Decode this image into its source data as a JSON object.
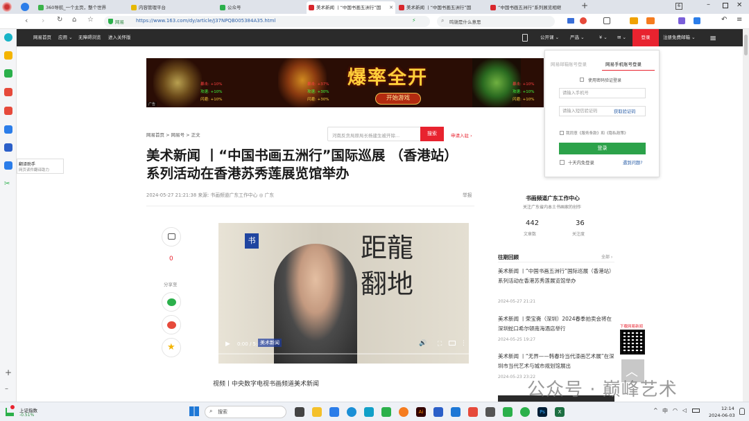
{
  "browser": {
    "tabs": [
      {
        "label": "360导航_一个主页，整个世界"
      },
      {
        "label": "内容管理平台"
      },
      {
        "label": "公众号"
      },
      {
        "label": "美术新闻 丨“中国书画五洲行”国"
      },
      {
        "label": "美术新闻 丨“中国书画五洲行”国"
      },
      {
        "label": "“中国书画五洲行”系列展览相继"
      }
    ],
    "new_tab": "+",
    "window_count": "6",
    "url_prefix": "网易",
    "url": "https://www.163.com/dy/article/J37NPQB005384A35.html",
    "search_placeholder": "鸣谢是什么意思"
  },
  "site_nav": {
    "left": [
      "网易首页",
      "应用 ⌄",
      "无障碍浏览",
      "进入关怀版"
    ],
    "right": [
      "公开课 ⌄",
      "严选 ⌄",
      "¥ ⌄",
      "✉ ⌄"
    ],
    "login": "登录",
    "register": "注册免费邮箱 ⌄"
  },
  "banner": {
    "title": "爆率全开",
    "button": "开始游戏",
    "tag": "广告",
    "stats_left": [
      "暴击: +10%",
      "攻速: +10%",
      "闪避: +10%"
    ],
    "stats_mid": [
      "暴击: +37%",
      "攻速: +30%",
      "闪避: +30%"
    ],
    "stats_right": [
      "暴击: +10%",
      "攻速: +10%",
      "闪避: +10%"
    ]
  },
  "breadcrumb": "网易首页 > 网易号 > 正文",
  "article_search": {
    "placeholder": "河南反贪局原局长杨建生被开除...",
    "button": "搜索",
    "apply": "申请入驻 ›"
  },
  "article": {
    "title": "美术新闻 丨“中国书画五洲行”国际巡展 （香港站）系列活动在香港苏秀莲展览馆举办",
    "meta": "2024-05-27 21:21:38  来源: 书画频道广东工作中心  ◎ 广东",
    "report": "举报",
    "caption": "视频丨中央数字电视书画频道美术新闻"
  },
  "share": {
    "comment_count": "0",
    "share_label": "分享至"
  },
  "video": {
    "time": "0:00 / 5:45",
    "logo_text": "美术新闻"
  },
  "login_panel": {
    "tab_email": "网易邮箱账号登录",
    "tab_phone": "网易手机账号登录",
    "pwd_login": "使用密码验证登录",
    "phone_placeholder": "请输入手机号",
    "code_placeholder": "请输入短信验证码",
    "get_code": "获取验证码",
    "agree": "我同意《服务条款》和《隐私政策》",
    "submit": "登录",
    "remember": "十天内免登录",
    "problem": "遇到问题?"
  },
  "author": {
    "name": "书画频道广东工作中心",
    "desc": "关注广东省内本土书画家的创作",
    "articles": "442",
    "articles_label": "文章数",
    "followers": "36",
    "followers_label": "关注度"
  },
  "past": {
    "title": "往期回顾",
    "more": "全部 ›",
    "items": [
      {
        "title": "美术新闻 丨“中国书画五洲行”国际巡展（香港站）系列活动在香港苏秀莲展览馆举办",
        "date": "2024-05-27 21:21"
      },
      {
        "title": "美术新闻 丨荣宝斋（深圳）2024春季拍卖会将在深圳蛇口希尔顿南海酒店举行",
        "date": "2024-05-25 19:27"
      },
      {
        "title": "美术新闻 丨“无界——韩春玲当代漆画艺术展”在深圳市当代艺术与城市规划馆展出",
        "date": "2024-05-23 23:22"
      }
    ],
    "qr_label": "下载网易新闻"
  },
  "sidebar_popup": {
    "title": "翻译助手",
    "sub": "网页读件翻译助力"
  },
  "watermark": "公众号 · 巅峰艺术",
  "taskbar": {
    "stock_name": "上证指数",
    "stock_change": "-0.51%",
    "search": "搜索",
    "time": "12:14",
    "date": "2024-06-03",
    "input": "中"
  }
}
